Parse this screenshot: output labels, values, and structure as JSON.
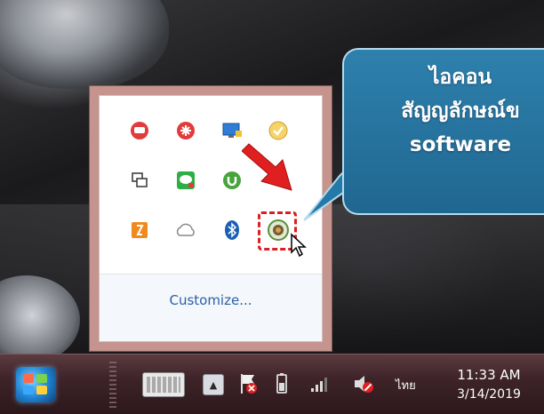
{
  "tray_popup": {
    "customize_label": "Customize...",
    "icons": [
      {
        "name": "red-chat-app-icon",
        "color": "#e23b3b"
      },
      {
        "name": "red-asterisk-app-icon",
        "color": "#e23b3b"
      },
      {
        "name": "monitor-app-icon",
        "color": "#2f7dd8"
      },
      {
        "name": "yellow-check-app-icon",
        "color": "#f1c232"
      },
      {
        "name": "display-switch-icon",
        "color": "#333333"
      },
      {
        "name": "green-line-chat-icon",
        "color": "#2fae45"
      },
      {
        "name": "green-torrent-icon",
        "color": "#48a43c"
      },
      {
        "name": "orange-app-icon",
        "color": "#f08a1e"
      },
      {
        "name": "cloud-icon",
        "color": "#999999"
      },
      {
        "name": "bluetooth-icon",
        "color": "#1a5fb4"
      },
      {
        "name": "selected-software-icon",
        "color": "#5a8f3a"
      }
    ]
  },
  "callout": {
    "lines": [
      "ไอคอน",
      "สัญญลักษณ์ข",
      "software"
    ]
  },
  "taskbar": {
    "language": "ไทย",
    "time": "11:33 AM",
    "date": "3/14/2019",
    "show_hidden_glyph": "▲"
  },
  "colors": {
    "highlight": "#d91f1f",
    "callout_bg": "#2479a6",
    "taskbar_bg": "#3e2429",
    "popup_border": "#c5948e",
    "link": "#2a5fa8"
  }
}
